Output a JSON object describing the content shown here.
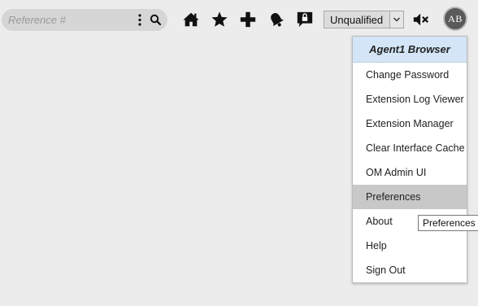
{
  "search": {
    "placeholder": "Reference #",
    "value": ""
  },
  "toolbar": {
    "icons": [
      "home-icon",
      "star-icon",
      "plus-icon",
      "bell-icon",
      "chat-lock-icon",
      "mute-icon"
    ]
  },
  "qualification": {
    "selected": "Unqualified"
  },
  "user": {
    "initials": "AB"
  },
  "menu": {
    "title": "Agent1 Browser",
    "items": [
      {
        "label": "Change Password"
      },
      {
        "label": "Extension Log Viewer"
      },
      {
        "label": "Extension Manager"
      },
      {
        "label": "Clear Interface Cache"
      },
      {
        "label": "OM Admin UI"
      },
      {
        "label": "Preferences",
        "active": true
      },
      {
        "label": "About"
      },
      {
        "label": "Help"
      },
      {
        "label": "Sign Out"
      }
    ]
  },
  "tooltip": {
    "text": "Preferences"
  },
  "colors": {
    "background": "#ececec",
    "search_bg": "#d6d6d6",
    "menu_header_bg": "#d3e5f7",
    "menu_active_bg": "#c8c8c8",
    "icon": "#111111"
  }
}
